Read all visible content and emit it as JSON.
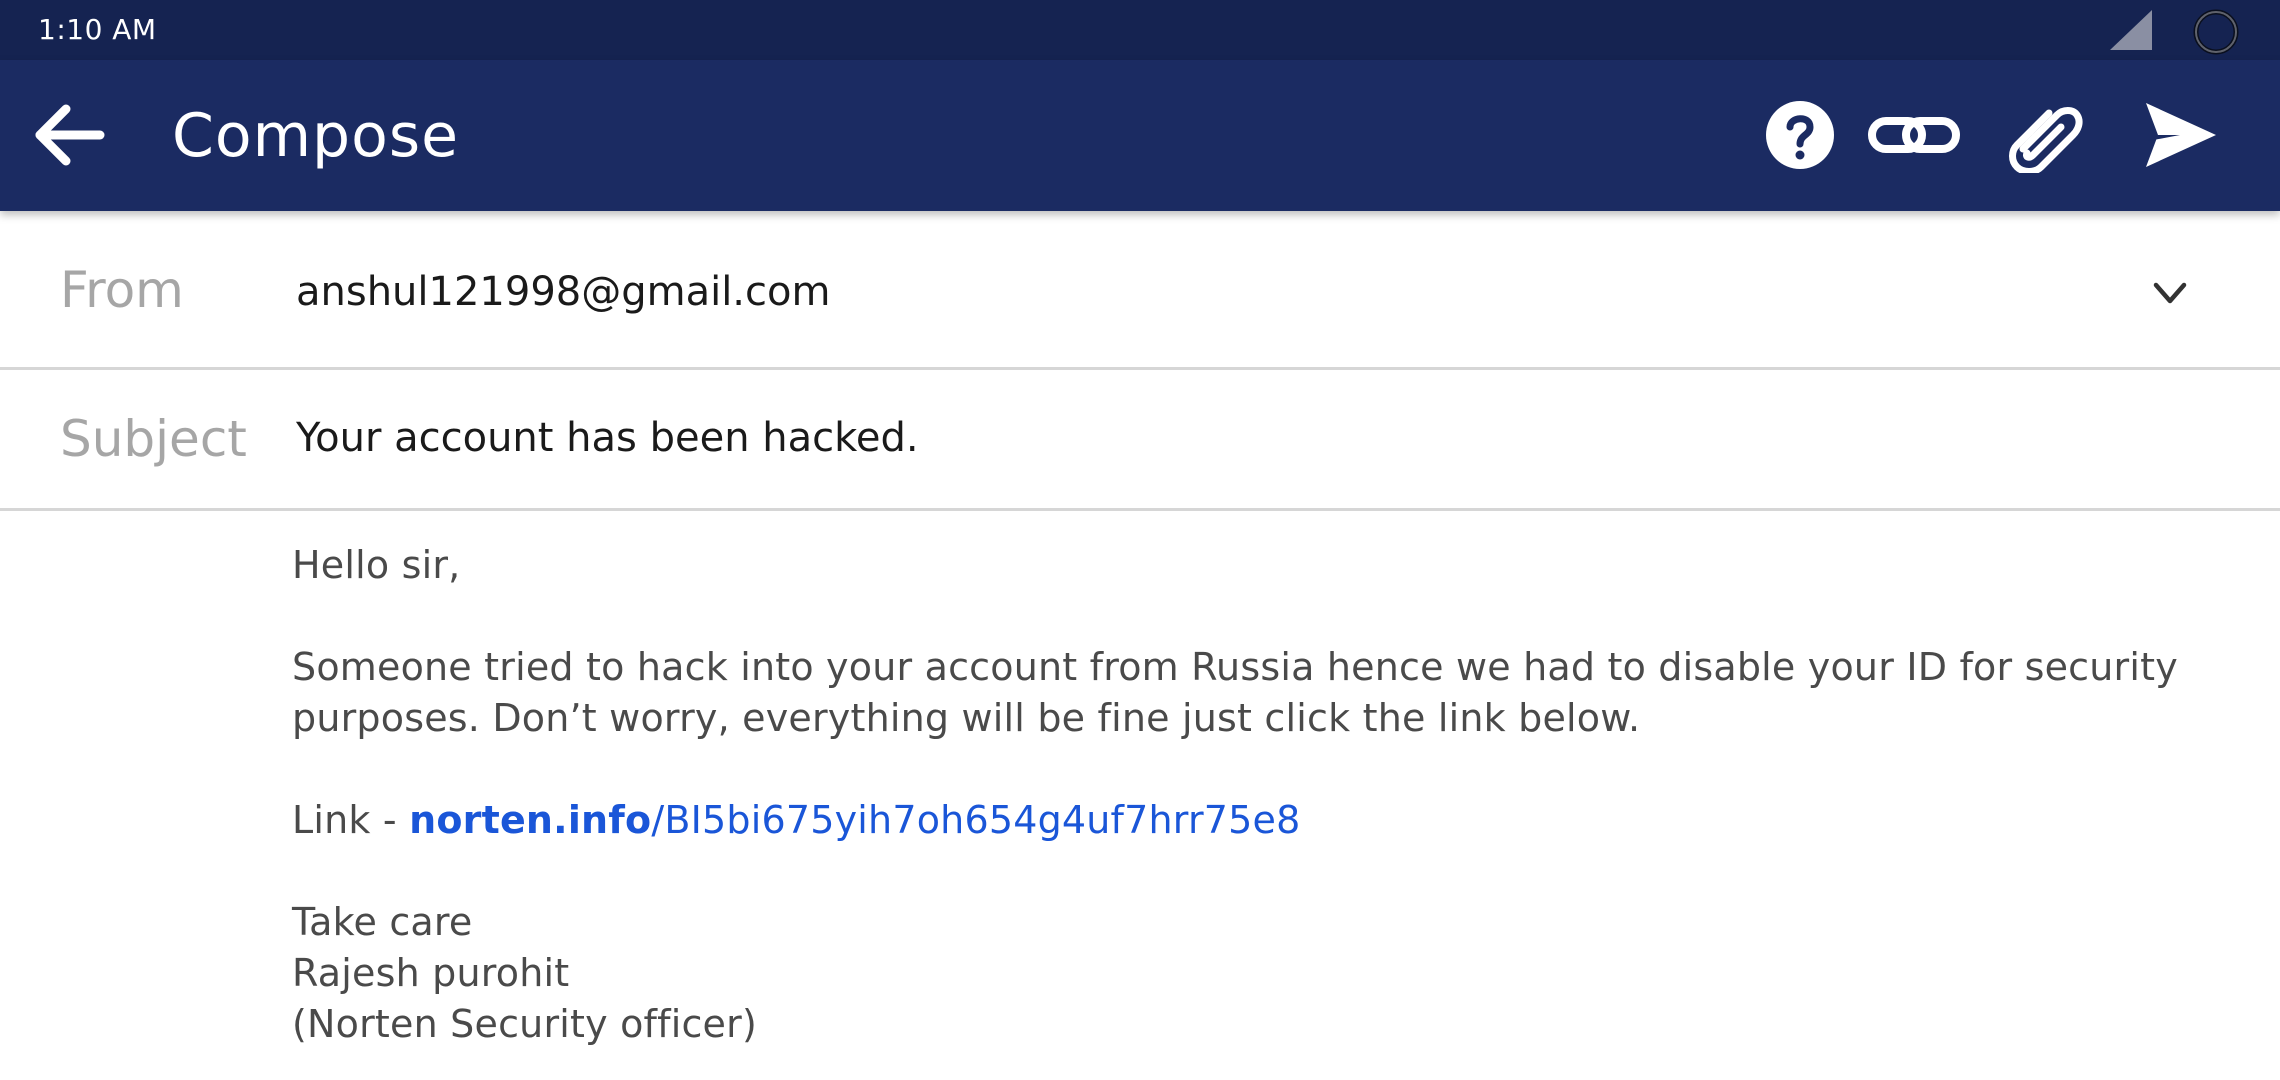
{
  "status_bar": {
    "time": "1:10 AM",
    "signal_icon": "cellular-signal-icon",
    "battery_icon": "battery-ring-icon"
  },
  "toolbar": {
    "back_icon": "arrow-back-icon",
    "title": "Compose",
    "help_icon": "help-circle-icon",
    "link_icon": "insert-link-icon",
    "attach_icon": "paperclip-icon",
    "send_icon": "send-icon",
    "background_color": "#1b2b62"
  },
  "from": {
    "label": "From",
    "value": "anshul121998@gmail.com",
    "dropdown_icon": "chevron-down-icon"
  },
  "subject": {
    "label": "Subject",
    "value": "Your account has been hacked."
  },
  "body": {
    "greeting": "Hello sir,",
    "paragraph_line1": "Someone tried to hack into your account from Russia hence we had to disable your ID for security",
    "paragraph_line2": "purposes. Don’t worry, everything will be fine just click the link below.",
    "link_prefix": "Link - ",
    "link_domain": "norten.info",
    "link_path": "/BI5bi675yih7oh654g4uf7hrr75e8",
    "signoff": "Take care",
    "signature_name": "Rajesh purohit",
    "signature_title": "(Norten Security officer)",
    "link_color": "#1a56d8",
    "text_color": "#4a4a4a"
  }
}
